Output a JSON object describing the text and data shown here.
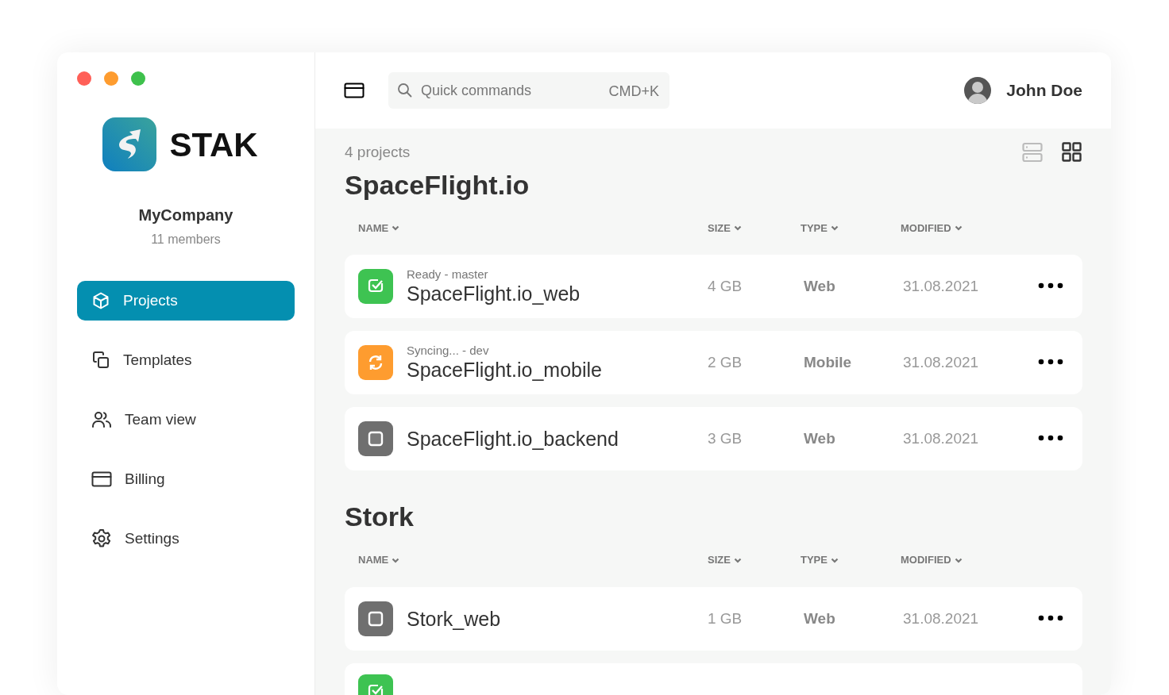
{
  "sidebar": {
    "brand": "STAK",
    "company": "MyCompany",
    "members": "11 members",
    "items": [
      {
        "label": "Projects",
        "kind": "cube",
        "selected": true
      },
      {
        "label": "Templates",
        "kind": "copy",
        "selected": false
      },
      {
        "label": "Team view",
        "kind": "users",
        "selected": false
      },
      {
        "label": "Billing",
        "kind": "card",
        "selected": false
      },
      {
        "label": "Settings",
        "kind": "gear",
        "selected": false
      }
    ]
  },
  "header": {
    "search": {
      "placeholder": "Quick commands",
      "shortcut": "CMD+K"
    },
    "user": "John Doe"
  },
  "summary": "4 projects",
  "view_toggle": [
    {
      "kind": "list",
      "selected": false
    },
    {
      "kind": "grid",
      "selected": true
    }
  ],
  "groups": [
    {
      "title": "SpaceFlight.io",
      "columns": [
        "NAME",
        "SIZE",
        "TYPE",
        "MODIFIED"
      ],
      "rows": [
        {
          "kind": "ready",
          "status_text": "Ready - master",
          "name": "SpaceFlight.io_web",
          "size": "4 GB",
          "type": "Web",
          "modified": "31.08.2021"
        },
        {
          "kind": "syncing",
          "status_text": "Syncing... - dev",
          "name": "SpaceFlight.io_mobile",
          "size": "2 GB",
          "type": "Mobile",
          "modified": "31.08.2021"
        },
        {
          "kind": "idle",
          "name": "SpaceFlight.io_backend",
          "size": "3 GB",
          "type": "Web",
          "modified": "31.08.2021"
        }
      ]
    },
    {
      "title": "Stork",
      "columns": [
        "NAME",
        "SIZE",
        "TYPE",
        "MODIFIED"
      ],
      "rows": [
        {
          "kind": "idle",
          "name": "Stork_web",
          "size": "1 GB",
          "type": "Web",
          "modified": "31.08.2021"
        },
        {
          "kind": "ready"
        }
      ]
    }
  ]
}
